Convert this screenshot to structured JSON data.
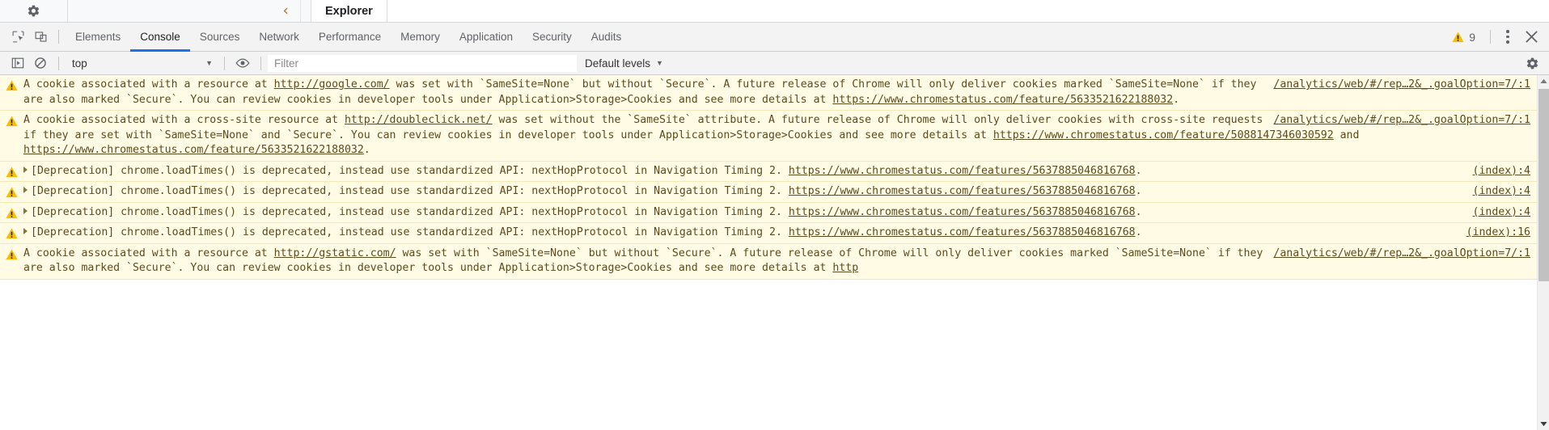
{
  "app_strip": {
    "gear_icon": "gear-icon",
    "back_icon": "chevron-left-icon",
    "tab_label": "Explorer"
  },
  "devtools": {
    "inspect_icon": "inspect-element-icon",
    "device_icon": "device-toolbar-icon",
    "tabs": [
      {
        "label": "Elements",
        "active": false
      },
      {
        "label": "Console",
        "active": true
      },
      {
        "label": "Sources",
        "active": false
      },
      {
        "label": "Network",
        "active": false
      },
      {
        "label": "Performance",
        "active": false
      },
      {
        "label": "Memory",
        "active": false
      },
      {
        "label": "Application",
        "active": false
      },
      {
        "label": "Security",
        "active": false
      },
      {
        "label": "Audits",
        "active": false
      }
    ],
    "warning_icon": "warning-triangle-icon",
    "warning_count": "9",
    "more_icon": "more-vertical-icon",
    "close_icon": "close-icon",
    "active_tab_underline_color": "#1a73e8"
  },
  "console_toolbar": {
    "sidebar_toggle_icon": "console-sidebar-toggle-icon",
    "clear_icon": "clear-console-icon",
    "context_value": "top",
    "context_caret_icon": "caret-down-icon",
    "eye_icon": "live-expression-eye-icon",
    "filter_placeholder": "Filter",
    "filter_value": "",
    "levels_value": "Default levels",
    "levels_caret_icon": "caret-down-icon",
    "settings_icon": "gear-icon"
  },
  "console_messages": [
    {
      "level_icon": "warning-triangle-icon",
      "expandable": false,
      "source": "/analytics/web/#/rep…2&_.goalOption=7/:1",
      "source_inline": false,
      "parts": [
        {
          "t": "A cookie associated with a resource at ",
          "link": false
        },
        {
          "t": "http://google.com/",
          "link": true
        },
        {
          "t": " was set with `SameSite=None` but without `Secure`. A future release of Chrome will only deliver cookies marked `SameSite=None` if they are also marked `Secure`. You can review cookies in developer tools under Application>Storage>Cookies and see more details at ",
          "link": false
        },
        {
          "t": "https://www.chromestatus.com/feature/5633521622188032",
          "link": true
        },
        {
          "t": ".",
          "link": false
        }
      ]
    },
    {
      "level_icon": "warning-triangle-icon",
      "expandable": false,
      "source": "/analytics/web/#/rep…2&_.goalOption=7/:1",
      "source_inline": false,
      "parts": [
        {
          "t": "A cookie associated with a cross-site resource at ",
          "link": false
        },
        {
          "t": "http://doubleclick.net/",
          "link": true
        },
        {
          "t": " was set without the `SameSite` attribute. A future release of Chrome will only deliver cookies with cross-site requests if they are set with `SameSite=None` and `Secure`. You can review cookies in developer tools under Application>Storage>Cookies and see more details at ",
          "link": false
        },
        {
          "t": "https://www.chromestatus.com/feature/5088147346030592",
          "link": true
        },
        {
          "t": " and ",
          "link": false
        },
        {
          "t": "https://www.chromestatus.com/feature/5633521622188032",
          "link": true
        },
        {
          "t": ".",
          "link": false
        }
      ]
    },
    {
      "level_icon": "warning-triangle-icon",
      "expandable": true,
      "source": "(index):4",
      "source_inline": false,
      "parts": [
        {
          "t": "[Deprecation] chrome.loadTimes() is deprecated, instead use standardized API: nextHopProtocol in Navigation Timing 2. ",
          "link": false
        },
        {
          "t": "https://www.chromestatus.com/features/5637885046816768",
          "link": true
        },
        {
          "t": ".",
          "link": false
        }
      ]
    },
    {
      "level_icon": "warning-triangle-icon",
      "expandable": true,
      "source": "(index):4",
      "source_inline": false,
      "parts": [
        {
          "t": "[Deprecation] chrome.loadTimes() is deprecated, instead use standardized API: nextHopProtocol in Navigation Timing 2. ",
          "link": false
        },
        {
          "t": "https://www.chromestatus.com/features/5637885046816768",
          "link": true
        },
        {
          "t": ".",
          "link": false
        }
      ]
    },
    {
      "level_icon": "warning-triangle-icon",
      "expandable": true,
      "source": "(index):4",
      "source_inline": false,
      "parts": [
        {
          "t": "[Deprecation] chrome.loadTimes() is deprecated, instead use standardized API: nextHopProtocol in Navigation Timing 2. ",
          "link": false
        },
        {
          "t": "https://www.chromestatus.com/features/5637885046816768",
          "link": true
        },
        {
          "t": ".",
          "link": false
        }
      ]
    },
    {
      "level_icon": "warning-triangle-icon",
      "expandable": true,
      "source": "(index):16",
      "source_inline": false,
      "parts": [
        {
          "t": "[Deprecation] chrome.loadTimes() is deprecated, instead use standardized API: nextHopProtocol in Navigation Timing 2. ",
          "link": false
        },
        {
          "t": "https://www.chromestatus.com/features/5637885046816768",
          "link": true
        },
        {
          "t": ".",
          "link": false
        }
      ]
    },
    {
      "level_icon": "warning-triangle-icon",
      "expandable": false,
      "source": "/analytics/web/#/rep…2&_.goalOption=7/:1",
      "source_inline": false,
      "parts": [
        {
          "t": "A cookie associated with a resource at ",
          "link": false
        },
        {
          "t": "http://gstatic.com/",
          "link": true
        },
        {
          "t": " was set with `SameSite=None` but without `Secure`. A future release of Chrome will only deliver cookies marked `SameSite=None` if they are also marked `Secure`. You can review cookies in developer tools under Application>Storage>Cookies and see more details at ",
          "link": false
        },
        {
          "t": "http",
          "link": true
        }
      ]
    }
  ],
  "scrollbar": {
    "up_arrow_icon": "scroll-up-arrow-icon",
    "down_arrow_icon": "scroll-down-arrow-icon",
    "thumb": "scrollbar-thumb"
  }
}
